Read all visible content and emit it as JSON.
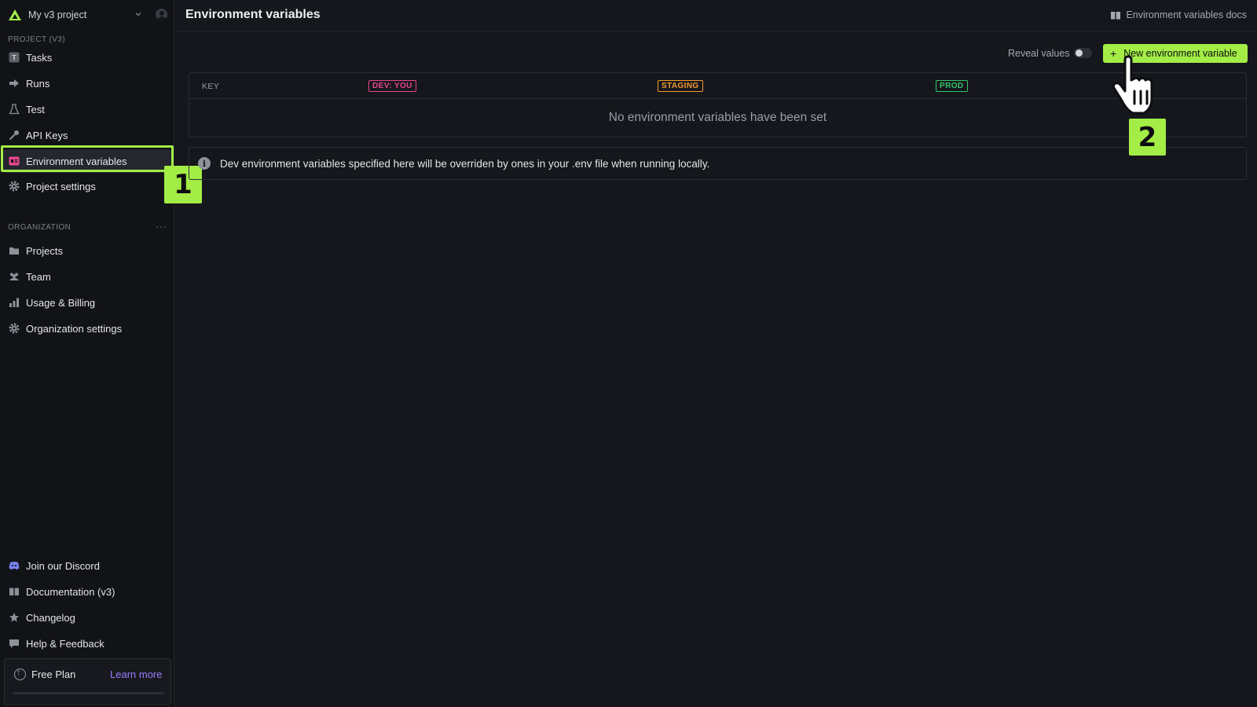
{
  "project": {
    "name": "My v3 project"
  },
  "sidebar": {
    "project_section": "PROJECT (V3)",
    "project_items": [
      {
        "label": "Tasks",
        "icon": "tasks-icon"
      },
      {
        "label": "Runs",
        "icon": "runs-icon"
      },
      {
        "label": "Test",
        "icon": "flask-icon"
      },
      {
        "label": "API Keys",
        "icon": "key-icon"
      },
      {
        "label": "Environment variables",
        "icon": "env-vars-icon",
        "active": true
      },
      {
        "label": "Project settings",
        "icon": "gear-icon"
      }
    ],
    "org_section": "ORGANIZATION",
    "org_items": [
      {
        "label": "Projects",
        "icon": "folder-icon"
      },
      {
        "label": "Team",
        "icon": "team-icon"
      },
      {
        "label": "Usage & Billing",
        "icon": "bar-chart-icon"
      },
      {
        "label": "Organization settings",
        "icon": "gear-icon"
      }
    ],
    "footer_items": [
      {
        "label": "Join our Discord",
        "icon": "discord-icon"
      },
      {
        "label": "Documentation (v3)",
        "icon": "book-icon"
      },
      {
        "label": "Changelog",
        "icon": "star-icon"
      },
      {
        "label": "Help & Feedback",
        "icon": "chat-icon"
      }
    ],
    "plan": {
      "label": "Free Plan",
      "link": "Learn more"
    }
  },
  "header": {
    "title": "Environment variables",
    "docs_link": "Environment variables docs"
  },
  "toolbar": {
    "reveal_label": "Reveal values",
    "reveal_on": false,
    "new_button": "New environment variable"
  },
  "table": {
    "key_header": "KEY",
    "env_tags": [
      "DEV: YOU",
      "STAGING",
      "PROD"
    ],
    "empty_message": "No environment variables have been set"
  },
  "info": {
    "message": "Dev environment variables specified here will be overriden by ones in your .env file when running locally."
  },
  "annotations": {
    "step1": "1",
    "step2": "2"
  },
  "colors": {
    "accent": "#a3ed46",
    "dev": "#e8478f",
    "staging": "#f39a2f",
    "prod": "#36c46a",
    "link": "#9b7bff"
  }
}
